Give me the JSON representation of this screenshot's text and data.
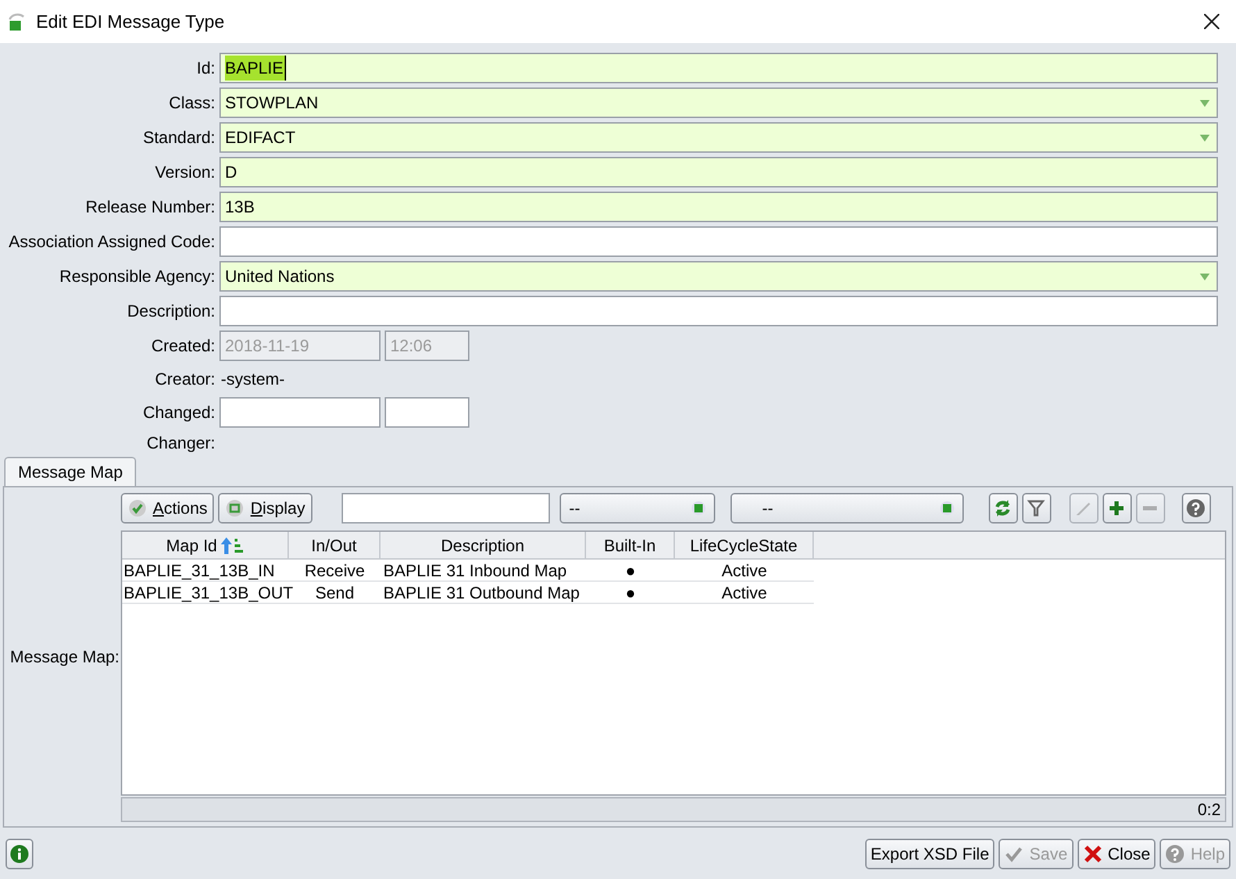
{
  "window": {
    "title": "Edit EDI Message Type"
  },
  "form": {
    "fields": [
      {
        "label": "Id:",
        "kind": "text",
        "value": "BAPLIE",
        "required": true,
        "highlighted": true
      },
      {
        "label": "Class:",
        "kind": "dropdown",
        "value": "STOWPLAN",
        "required": true,
        "highlighted": false
      },
      {
        "label": "Standard:",
        "kind": "dropdown",
        "value": "EDIFACT",
        "required": true,
        "highlighted": false
      },
      {
        "label": "Version:",
        "kind": "text",
        "value": "D",
        "required": true,
        "highlighted": false
      },
      {
        "label": "Release Number:",
        "kind": "text",
        "value": "13B",
        "required": true,
        "highlighted": false
      },
      {
        "label": "Association Assigned Code:",
        "kind": "text",
        "required": false
      },
      {
        "label": "Responsible Agency:",
        "kind": "dropdown",
        "value": "United Nations",
        "required": true,
        "highlighted": false
      },
      {
        "label": "Description:",
        "kind": "text",
        "required": false
      },
      {
        "label": "Created:",
        "kind": "datetime",
        "date": "2018-11-19",
        "time": "12:06",
        "disabled": true
      },
      {
        "label": "Creator:",
        "kind": "readonly",
        "value": "-system-"
      },
      {
        "label": "Changed:",
        "kind": "datetime",
        "disabled": false
      },
      {
        "label": "Changer:",
        "kind": "readonly"
      }
    ]
  },
  "tabs": [
    {
      "label": "Message Map",
      "selected": true
    }
  ],
  "message_map": {
    "label": "Message Map:",
    "toolbar": {
      "buttons": [
        {
          "label": "Actions",
          "kind": "check"
        },
        {
          "label": "Display",
          "kind": "display"
        }
      ],
      "dropdowns": [
        "--",
        "--"
      ],
      "icon_buttons": [
        {
          "kind": "refresh",
          "disabled": false
        },
        {
          "kind": "filter",
          "disabled": false
        },
        {
          "kind": "edit",
          "disabled": true
        },
        {
          "kind": "add",
          "disabled": false
        },
        {
          "kind": "remove",
          "disabled": true
        },
        {
          "kind": "help",
          "disabled": false
        }
      ]
    },
    "table": {
      "columns": [
        "Map Id",
        "In/Out",
        "Description",
        "Built-In",
        "LifeCycleState"
      ],
      "rows": [
        [
          "BAPLIE_31_13B_IN",
          "Receive",
          "BAPLIE 31 Inbound Map",
          "●",
          "Active"
        ],
        [
          "BAPLIE_31_13B_OUT",
          "Send",
          "BAPLIE 31 Outbound Map",
          "●",
          "Active"
        ]
      ]
    },
    "count": "0:2"
  },
  "footer": {
    "buttons": [
      {
        "label": "Export XSD File",
        "kind": "plain",
        "disabled": false
      },
      {
        "label": "Save",
        "kind": "save",
        "disabled": true
      },
      {
        "label": "Close",
        "kind": "close",
        "disabled": false
      },
      {
        "label": "Help",
        "kind": "help",
        "disabled": true
      }
    ]
  }
}
